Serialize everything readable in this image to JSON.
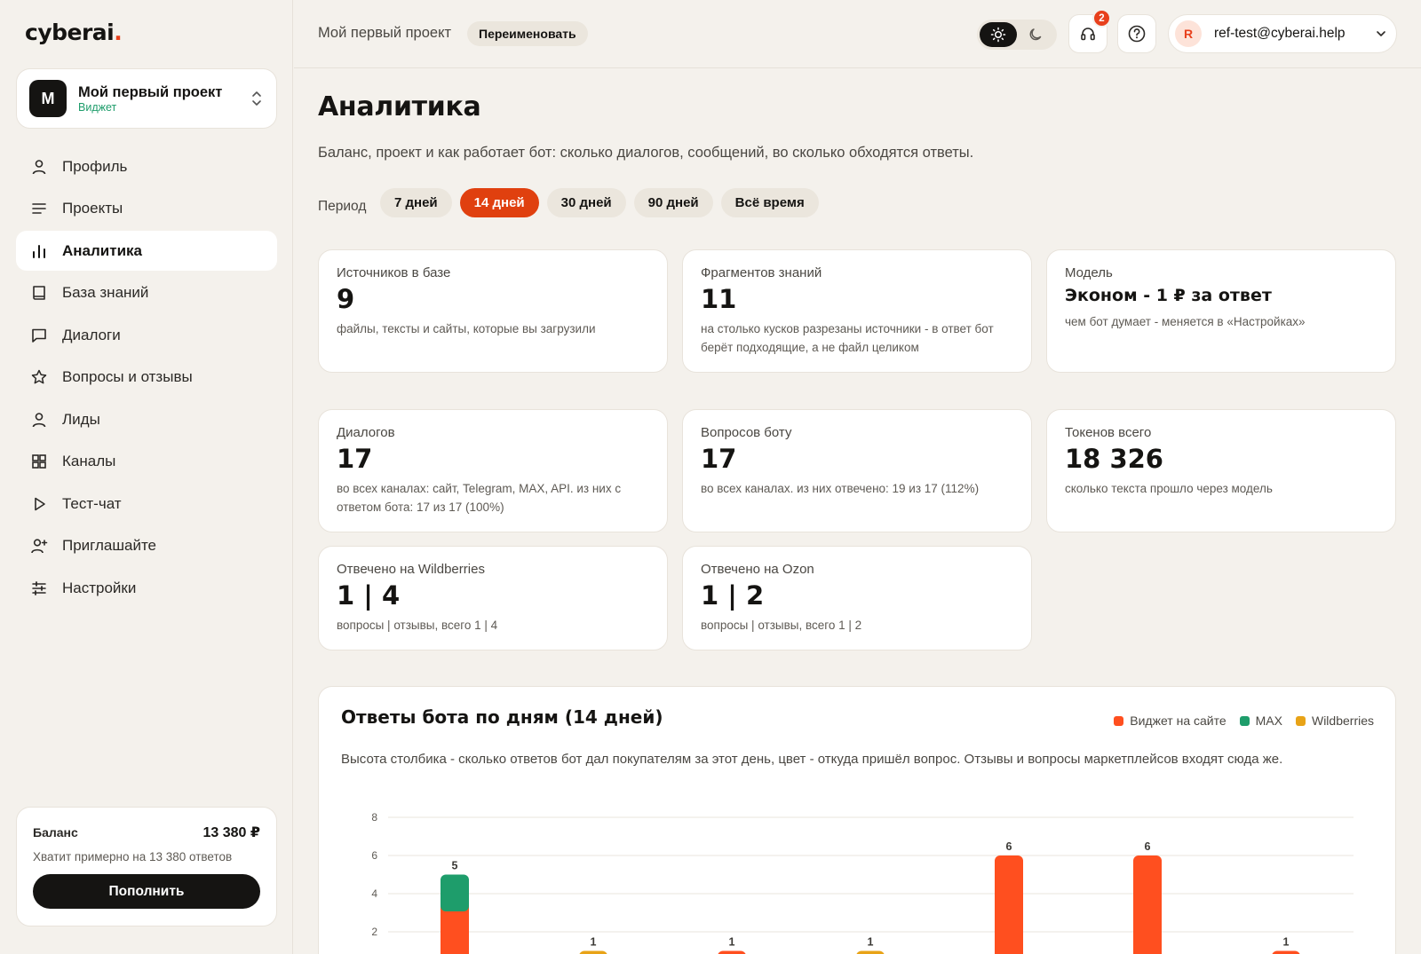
{
  "sidebar": {
    "logo": "cyberai",
    "logo_dot": ".",
    "project": {
      "initial": "M",
      "name": "Мой первый проект",
      "type": "Виджет"
    },
    "nav": [
      {
        "label": "Профиль",
        "icon": "user-icon"
      },
      {
        "label": "Проекты",
        "icon": "list-icon"
      },
      {
        "label": "Аналитика",
        "icon": "bar-chart-icon",
        "active": true
      },
      {
        "label": "База знаний",
        "icon": "book-icon"
      },
      {
        "label": "Диалоги",
        "icon": "chat-icon"
      },
      {
        "label": "Вопросы и отзывы",
        "icon": "star-icon"
      },
      {
        "label": "Лиды",
        "icon": "person-icon"
      },
      {
        "label": "Каналы",
        "icon": "grid-icon"
      },
      {
        "label": "Тест-чат",
        "icon": "play-icon"
      },
      {
        "label": "Приглашайте",
        "icon": "user-plus-icon"
      },
      {
        "label": "Настройки",
        "icon": "sliders-icon"
      }
    ],
    "balance": {
      "label": "Баланс",
      "value": "13 380 ₽",
      "hint": "Хватит примерно на 13 380 ответов",
      "button": "Пополнить"
    }
  },
  "topbar": {
    "project_name": "Мой первый проект",
    "rename": "Переименовать",
    "support_badge": "2",
    "user_initial": "R",
    "user_email": "ref-test@cyberai.help"
  },
  "main": {
    "title": "Аналитика",
    "description": "Баланс, проект и как работает бот: сколько диалогов, сообщений, во сколько обходятся ответы.",
    "period_label": "Период",
    "periods": [
      "7 дней",
      "14 дней",
      "30 дней",
      "90 дней",
      "Всё время"
    ],
    "active_period": 1,
    "cards_row1": [
      {
        "label": "Источников в базе",
        "value": "9",
        "hint": "файлы, тексты и сайты, которые вы загрузили"
      },
      {
        "label": "Фрагментов знаний",
        "value": "11",
        "hint": "на столько кусков разрезаны источники - в ответ бот берёт подходящие, а не файл целиком"
      },
      {
        "label": "Модель",
        "value": "Эконом - 1 ₽ за ответ",
        "hint": "чем бот думает - меняется в «Настройках»"
      }
    ],
    "cards_row2": [
      {
        "label": "Диалогов",
        "value": "17",
        "hint": "во всех каналах: сайт, Telegram, MAX, API. из них с ответом бота: 17 из 17 (100%)"
      },
      {
        "label": "Вопросов боту",
        "value": "17",
        "hint": "во всех каналах. из них отвечено: 19 из 17 (112%)"
      },
      {
        "label": "Токенов всего",
        "value": "18 326",
        "hint": "сколько текста прошло через модель"
      }
    ],
    "cards_row3": [
      {
        "label": "Отвечено на Wildberries",
        "value": "1 | 4",
        "hint": "вопросы | отзывы, всего 1 | 4"
      },
      {
        "label": "Отвечено на Ozon",
        "value": "1 | 2",
        "hint": "вопросы | отзывы, всего 1 | 2"
      }
    ],
    "chart_title": "Ответы бота по дням (14 дней)",
    "chart_description": "Высота столбика - сколько ответов бот дал покупателям за этот день, цвет - откуда пришёл вопрос. Отзывы и вопросы маркетплейсов входят сюда же."
  },
  "colors": {
    "accent": "#e0400f",
    "widget": "#ff4f1f",
    "max": "#1e9d6b",
    "wildberries": "#e8a317"
  },
  "chart_data": {
    "type": "bar",
    "stacked": true,
    "title": "Ответы бота по дням (14 дней)",
    "ylim": [
      0,
      8
    ],
    "yticks": [
      2,
      4,
      6,
      8
    ],
    "grid": true,
    "legend_position": "top-right",
    "series": [
      {
        "name": "Виджет на сайте",
        "color": "#ff4f1f",
        "values": [
          4,
          0,
          1,
          0,
          6,
          6,
          1
        ]
      },
      {
        "name": "MAX",
        "color": "#1e9d6b",
        "values": [
          1,
          0,
          0,
          0,
          0,
          0,
          0
        ]
      },
      {
        "name": "Wildberries",
        "color": "#e8a317",
        "values": [
          0,
          1,
          0,
          1,
          0,
          0,
          0
        ]
      }
    ],
    "totals": [
      5,
      1,
      1,
      1,
      6,
      6,
      1
    ]
  }
}
